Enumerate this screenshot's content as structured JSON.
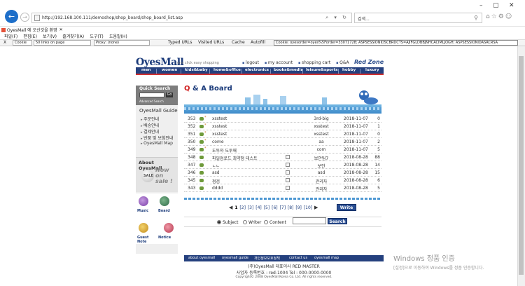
{
  "browser": {
    "url": "http://192.168.100.111/demoshop/shop_board/shop_board_list.asp",
    "search_placeholder": "검색...",
    "tab_title": "OyesMall 에 오신것을 환영",
    "menu": [
      "파일(F)",
      "편집(E)",
      "보기(V)",
      "즐겨찾기(A)",
      "도구(T)",
      "도움말(H)"
    ],
    "toolbar": {
      "close": "X",
      "cookie_select": "Cookie",
      "links_select": "50 links on page",
      "proxy_select": "Proxy: (none)",
      "typed_urls": "Typed URLs",
      "visited_urls": "Visited URLs",
      "cache": "Cache",
      "autofill": "Autofill",
      "cookie_string": "Cookie: oyesorder=oyes%5Forder=33071728; ASPSESSIONIDSCBRDCTS=AJIFGLDBBJNHCACIMLJOGH; ASPSESSIONIDASRCRSA"
    }
  },
  "site": {
    "logo": "OyesMall",
    "tagline": "one click easy shopping",
    "top_links": [
      "logout",
      "my account",
      "shopping cart",
      "Q&A"
    ],
    "red_zone": "Red Zone",
    "nav": [
      "men",
      "women",
      "kids&baby",
      "home&office",
      "electronics",
      "books&media",
      "leisure&sports",
      "hobby",
      "luxury"
    ]
  },
  "sidebar": {
    "quick_search": "Quick Search",
    "go": "Go",
    "advanced_search": "Advanced Search",
    "guide_title": "OyesMall Guide",
    "guide_items": [
      "주문안내",
      "배송안내",
      "결제안내",
      "반품 및 보험안내",
      "OyesMall Map"
    ],
    "about_title": "About OyesMall",
    "sale": "SALE",
    "now_on_sale": "Now on sale !",
    "tiles": [
      "Music",
      "Board",
      "Guest Note",
      "Notice"
    ]
  },
  "board": {
    "title_q": "Q",
    "title_rest": " & A Board",
    "rows": [
      {
        "no": "353",
        "subject": "xsstest",
        "writer": "3rd-big",
        "date": "2018-11-07",
        "hit": "0"
      },
      {
        "no": "352",
        "subject": "xsstest",
        "writer": "xsstest",
        "date": "2018-11-07",
        "hit": "1"
      },
      {
        "no": "351",
        "subject": "xsstest",
        "writer": "xsstest",
        "date": "2018-11-07",
        "hit": "0"
      },
      {
        "no": "350",
        "subject": "come",
        "writer": "aa",
        "date": "2018-11-07",
        "hit": "2"
      },
      {
        "no": "349",
        "subject": "도투와 도투왜",
        "writer": "com",
        "date": "2018-11-07",
        "hit": "5"
      },
      {
        "no": "348",
        "subject": "파일업로드 최약점 테스트",
        "writer": "보안팀7",
        "date": "2018-08-28",
        "hit": "88"
      },
      {
        "no": "347",
        "subject": "ㄴㄴ",
        "writer": "보안",
        "date": "2018-08-28",
        "hit": "14"
      },
      {
        "no": "346",
        "subject": "asd",
        "writer": "asd",
        "date": "2018-08-28",
        "hit": "15"
      },
      {
        "no": "345",
        "subject": "점검",
        "writer": "관리자",
        "date": "2018-08-28",
        "hit": "6"
      },
      {
        "no": "343",
        "subject": "dddd",
        "writer": "관리자",
        "date": "2018-08-28",
        "hit": "5"
      }
    ],
    "pages": [
      "1",
      "[2]",
      "[3]",
      "[4]",
      "[5]",
      "[6]",
      "[7]",
      "[8]",
      "[9]",
      "[10]"
    ],
    "write": "Write",
    "search_options": [
      "Subject",
      "Writer",
      "Content"
    ],
    "search": "Search"
  },
  "footer": {
    "links": [
      "about oyesmall",
      "oyesmall guide",
      "개인정보보호정책",
      "contact us",
      "oyesmall map"
    ],
    "line1": "(주)OyesMall 대표이사 RED MASTER",
    "line2": "사업자 등록번호 : red-1004  Tel : 000-0000-0000",
    "copyright": "Copyright© 2008 OyesMall Korea Co. Ltd. All rights reserved."
  },
  "watermark": {
    "line1": "Windows 정품 인증",
    "line2": "[설정]으로 이동하여 Windows를 정품 인증합니다."
  }
}
